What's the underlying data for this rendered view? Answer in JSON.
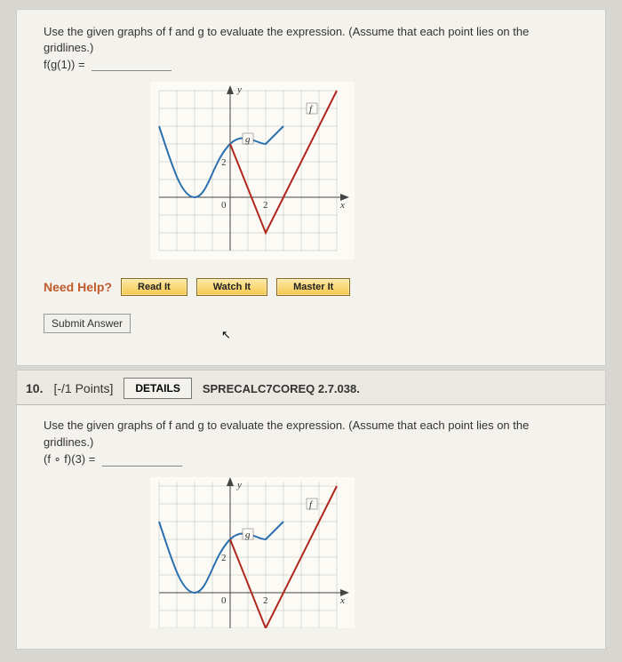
{
  "q1": {
    "prompt": "Use the given graphs of f and g to evaluate the expression. (Assume that each point lies on the gridlines.)",
    "expression": "f(g(1)) =",
    "need_help_label": "Need Help?",
    "read_it_label": "Read It",
    "watch_it_label": "Watch It",
    "master_it_label": "Master It",
    "submit_label": "Submit Answer"
  },
  "q2": {
    "number": "10.",
    "points": "[-/1 Points]",
    "details_label": "DETAILS",
    "code": "SPRECALC7COREQ 2.7.038.",
    "prompt": "Use the given graphs of f and g to evaluate the expression. (Assume that each point lies on the gridlines.)",
    "expression": "(f ∘ f)(3) ="
  },
  "chart_data": [
    {
      "type": "line",
      "title": "",
      "xlabel": "x",
      "ylabel": "y",
      "xlim": [
        -4,
        6
      ],
      "ylim": [
        -3,
        6
      ],
      "xticks": [
        0,
        2
      ],
      "yticks": [
        0,
        2
      ],
      "series": [
        {
          "name": "g",
          "color": "#2a6fb0",
          "x": [
            -4,
            -3,
            -2,
            -1,
            0,
            1,
            2,
            3
          ],
          "y": [
            4,
            2,
            0,
            2,
            3,
            3,
            3,
            4
          ]
        },
        {
          "name": "f",
          "color": "#b0271e",
          "x": [
            0,
            2,
            6
          ],
          "y": [
            3,
            -2,
            6
          ]
        }
      ],
      "labels": {
        "g": [
          1,
          3
        ],
        "f": [
          4.5,
          5
        ]
      }
    },
    {
      "type": "line",
      "title": "",
      "xlabel": "x",
      "ylabel": "y",
      "xlim": [
        -4,
        6
      ],
      "ylim": [
        -3,
        6
      ],
      "xticks": [
        0,
        2
      ],
      "yticks": [
        0,
        2
      ],
      "series": [
        {
          "name": "g",
          "color": "#2a6fb0",
          "x": [
            -4,
            -3,
            -2,
            -1,
            0,
            1,
            2,
            3
          ],
          "y": [
            4,
            2,
            0,
            2,
            3,
            3,
            3,
            4
          ]
        },
        {
          "name": "f",
          "color": "#b0271e",
          "x": [
            0,
            2,
            6
          ],
          "y": [
            3,
            -2,
            6
          ]
        }
      ],
      "labels": {
        "g": [
          1,
          3
        ],
        "f": [
          4.5,
          5
        ]
      }
    }
  ]
}
